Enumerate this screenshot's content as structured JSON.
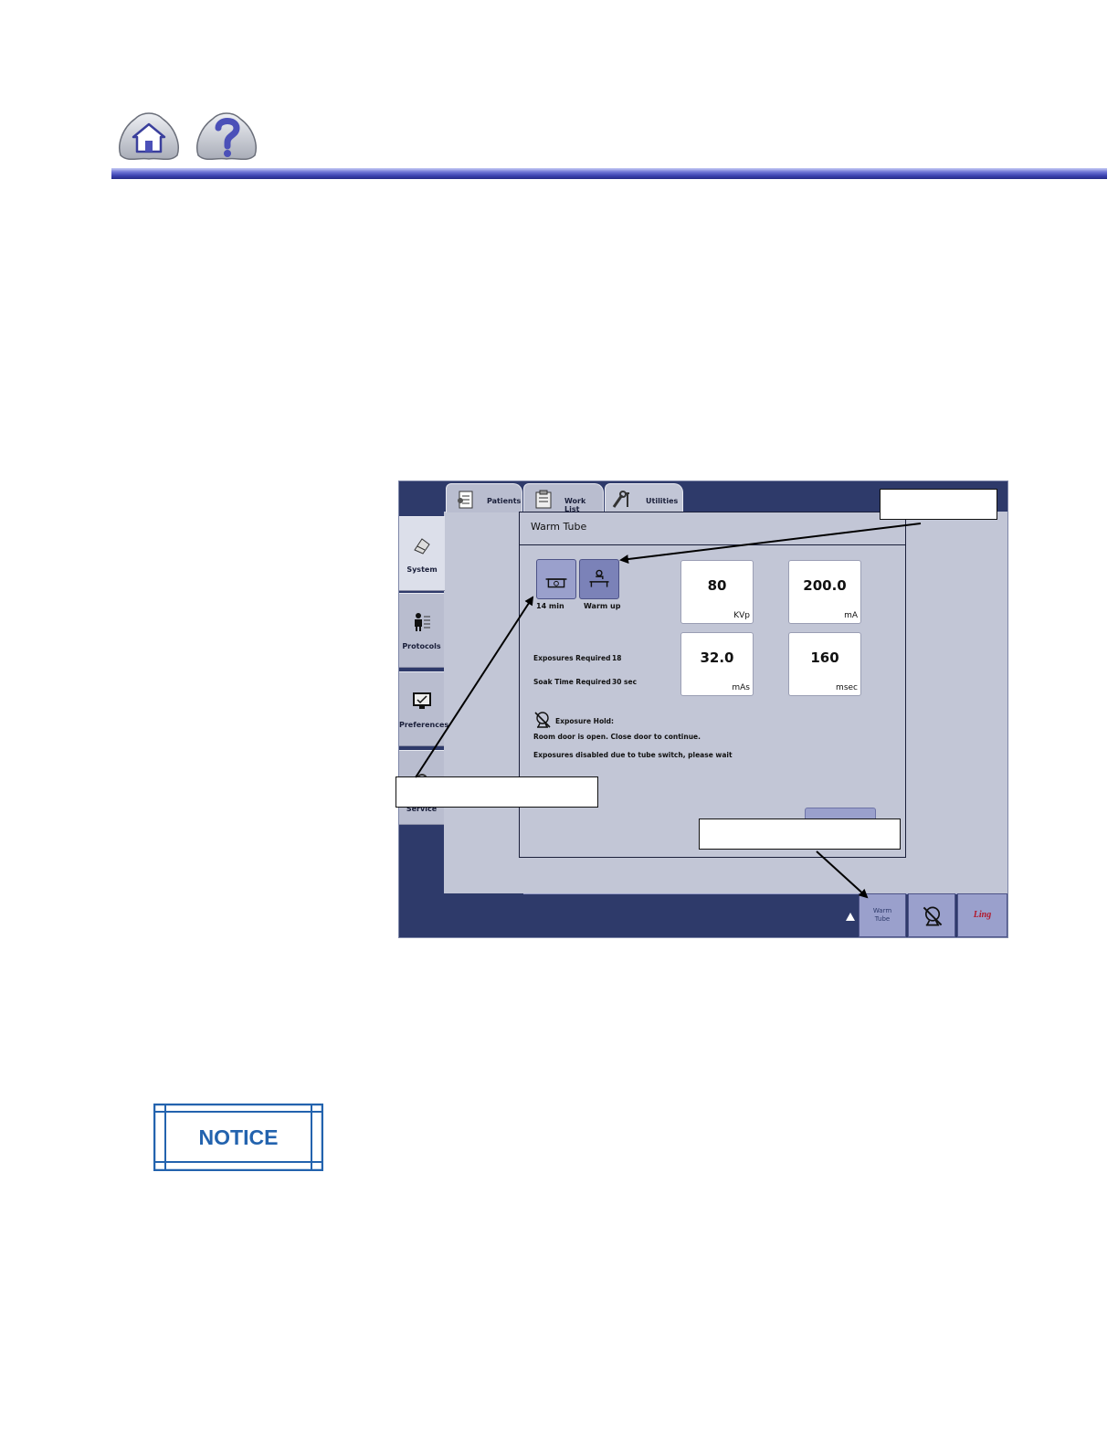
{
  "header": {
    "home_icon": "home-icon",
    "help_icon": "question-mark-icon",
    "bar_color": "#3b42b0"
  },
  "screen": {
    "top_tabs": [
      {
        "label": "Patients",
        "icon": "patient-chart-icon"
      },
      {
        "label": "Work List",
        "icon": "clipboard-icon"
      },
      {
        "label": "Utilities",
        "icon": "tools-icon"
      }
    ],
    "side_tabs": [
      {
        "label": "System",
        "icon": "system-icon"
      },
      {
        "label": "Protocols",
        "icon": "person-list-icon"
      },
      {
        "label": "Preferences",
        "icon": "monitor-icon"
      },
      {
        "label": "Service",
        "icon": "service-icon"
      }
    ],
    "dialog": {
      "title": "Warm Tube",
      "mode_buttons": [
        {
          "label": "14 min",
          "icon": "tube-soak-icon"
        },
        {
          "label": "Warm up",
          "icon": "tube-warmup-icon"
        }
      ],
      "values": [
        {
          "value": "80",
          "unit": "KVp"
        },
        {
          "value": "200.0",
          "unit": "mA"
        },
        {
          "value": "32.0",
          "unit": "mAs"
        },
        {
          "value": "160",
          "unit": "msec"
        }
      ],
      "exposures_required_label": "Exposures Required",
      "exposures_required_value": "18",
      "soak_time_label": "Soak Time Required",
      "soak_time_value": "30 sec",
      "exposure_hold_label": "Exposure Hold:",
      "room_door_msg": "Room door is open. Close door to continue.",
      "disabled_msg": "Exposures disabled due to tube switch, please wait"
    },
    "status_bar": {
      "warm_tube_label_line1": "Warm",
      "warm_tube_label_line2": "Tube",
      "exposure_icon": "no-exposure-icon",
      "logo_text": "Ling"
    }
  },
  "notice": {
    "label": "NOTICE",
    "color": "#2363ae"
  }
}
